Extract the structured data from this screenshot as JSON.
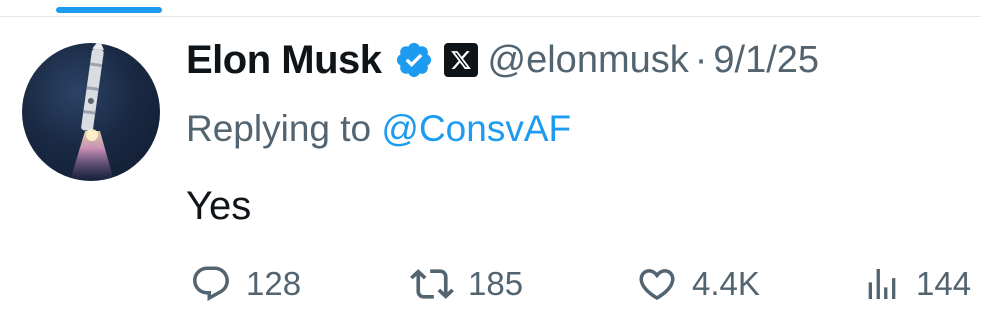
{
  "tweet": {
    "display_name": "Elon Musk",
    "handle": "@elonmusk",
    "separator": "·",
    "date": "9/1/25",
    "replying_prefix": "Replying to",
    "replying_to": "@ConsvAF",
    "text": "Yes",
    "verified_badge_icon": "verified-checkmark-icon",
    "affiliate_icon": "x-logo-icon",
    "avatar": "rocket-launch-avatar"
  },
  "actions": {
    "replies": "128",
    "retweets": "185",
    "likes": "4.4K",
    "views": "144"
  },
  "colors": {
    "accent": "#1d9bf0",
    "text": "#0f1419",
    "muted": "#536471"
  }
}
